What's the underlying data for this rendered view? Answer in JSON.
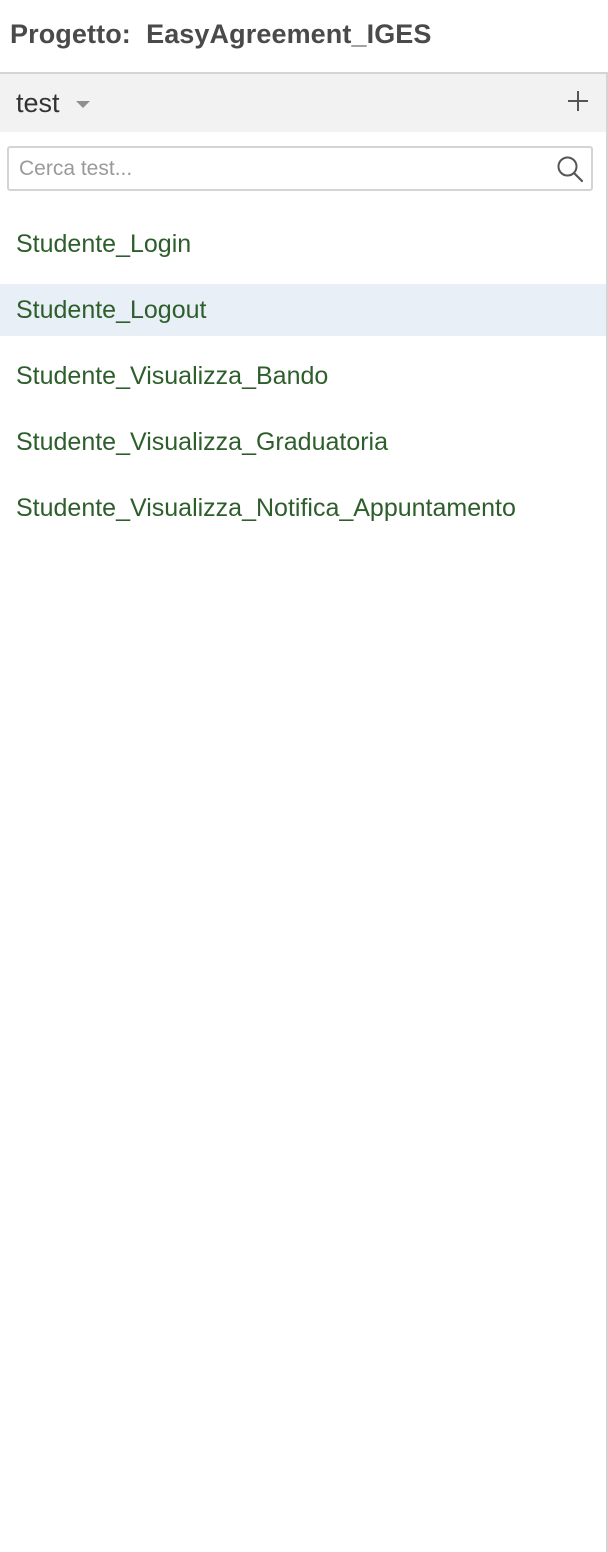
{
  "project": {
    "title": "Progetto:  EasyAgreement_IGES"
  },
  "toolbar": {
    "type_label": "test",
    "type_caret_icon": "caret-down-icon",
    "add_icon": "plus-icon"
  },
  "search": {
    "placeholder": "Cerca test...",
    "value": "",
    "icon": "search-icon"
  },
  "tests": {
    "selected_index": 1,
    "items": [
      {
        "label": "Studente_Login"
      },
      {
        "label": "Studente_Logout"
      },
      {
        "label": "Studente_Visualizza_Bando"
      },
      {
        "label": "Studente_Visualizza_Graduatoria"
      },
      {
        "label": "Studente_Visualizza_Notifica_Appuntamento"
      }
    ]
  },
  "colors": {
    "item_text": "#2d5e2b",
    "selected_background": "#e8eff6",
    "toolbar_background": "#f2f2f2",
    "title_text": "#4a4a4a"
  }
}
